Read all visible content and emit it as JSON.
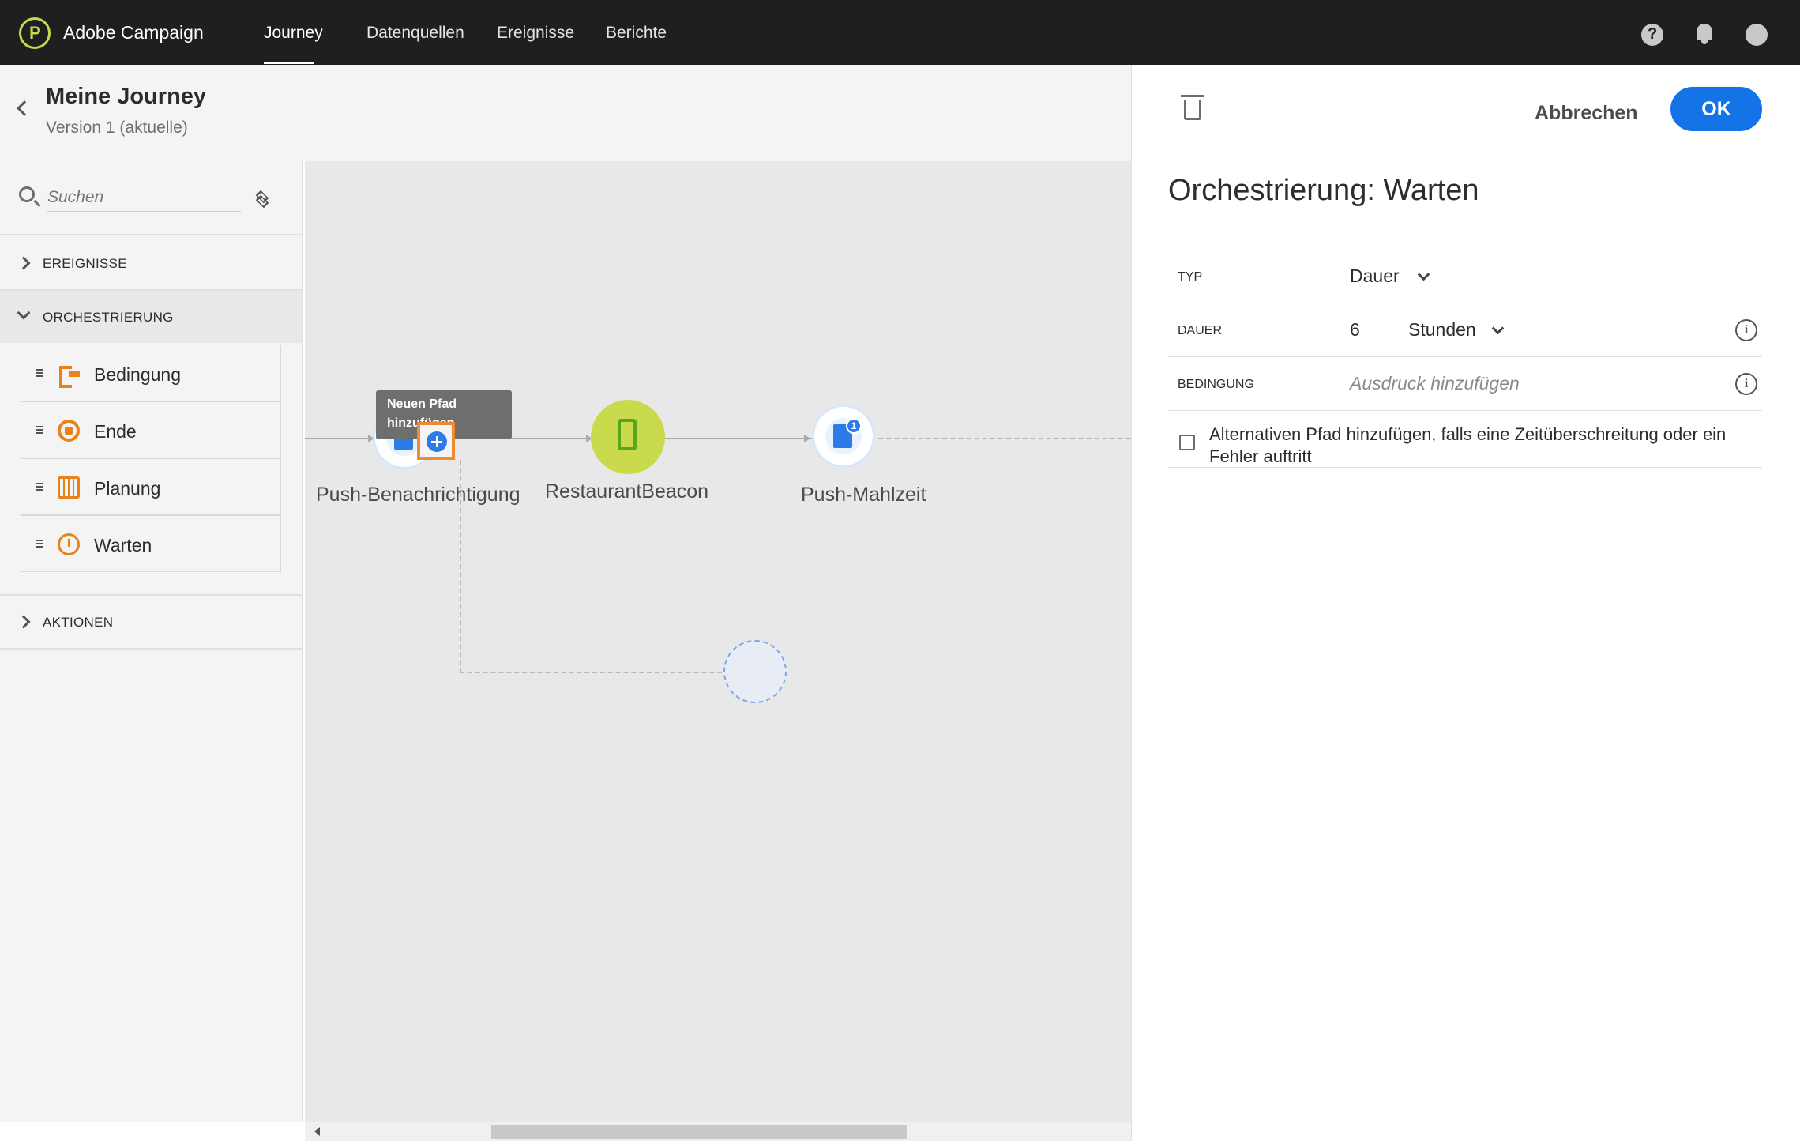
{
  "topbar": {
    "app_name": "Adobe Campaign",
    "nav": [
      "Journey",
      "Datenquellen",
      "Ereignisse",
      "Berichte"
    ],
    "active_nav": "Journey"
  },
  "journey": {
    "title": "Meine Journey",
    "version": "Version 1 (aktuelle)"
  },
  "sidebar": {
    "search_placeholder": "Suchen",
    "sections": {
      "events": "EREIGNISSE",
      "orchestration": "ORCHESTRIERUNG",
      "actions": "AKTIONEN"
    },
    "orchestration_items": [
      {
        "label": "Bedingung",
        "icon": "condition-icon"
      },
      {
        "label": "Ende",
        "icon": "end-icon"
      },
      {
        "label": "Planung",
        "icon": "calendar-icon"
      },
      {
        "label": "Warten",
        "icon": "clock-icon"
      }
    ]
  },
  "canvas": {
    "tooltip": "Neuen Pfad hinzufügen",
    "nodes": [
      {
        "label": "Push-Benachrichtigung",
        "type": "push"
      },
      {
        "label": "RestaurantBeacon",
        "type": "event"
      },
      {
        "label": "Push-Mahlzeit",
        "type": "push",
        "badge": "1"
      }
    ]
  },
  "panel": {
    "title": "Orchestrierung: Warten",
    "cancel_label": "Abbrechen",
    "ok_label": "OK",
    "fields": {
      "type_label": "TYP",
      "type_value": "Dauer",
      "duration_label": "DAUER",
      "duration_value": "6",
      "duration_unit": "Stunden",
      "condition_label": "BEDINGUNG",
      "condition_placeholder": "Ausdruck hinzufügen"
    },
    "alt_path_label": "Alternativen Pfad hinzufügen, falls eine Zeitüberschreitung oder ein Fehler auftritt",
    "alt_path_checked": false
  },
  "colors": {
    "accent": "#1473e6",
    "orchestration": "#e8831c",
    "event_node": "#c9db4c",
    "topbar": "#1f1f1f"
  }
}
